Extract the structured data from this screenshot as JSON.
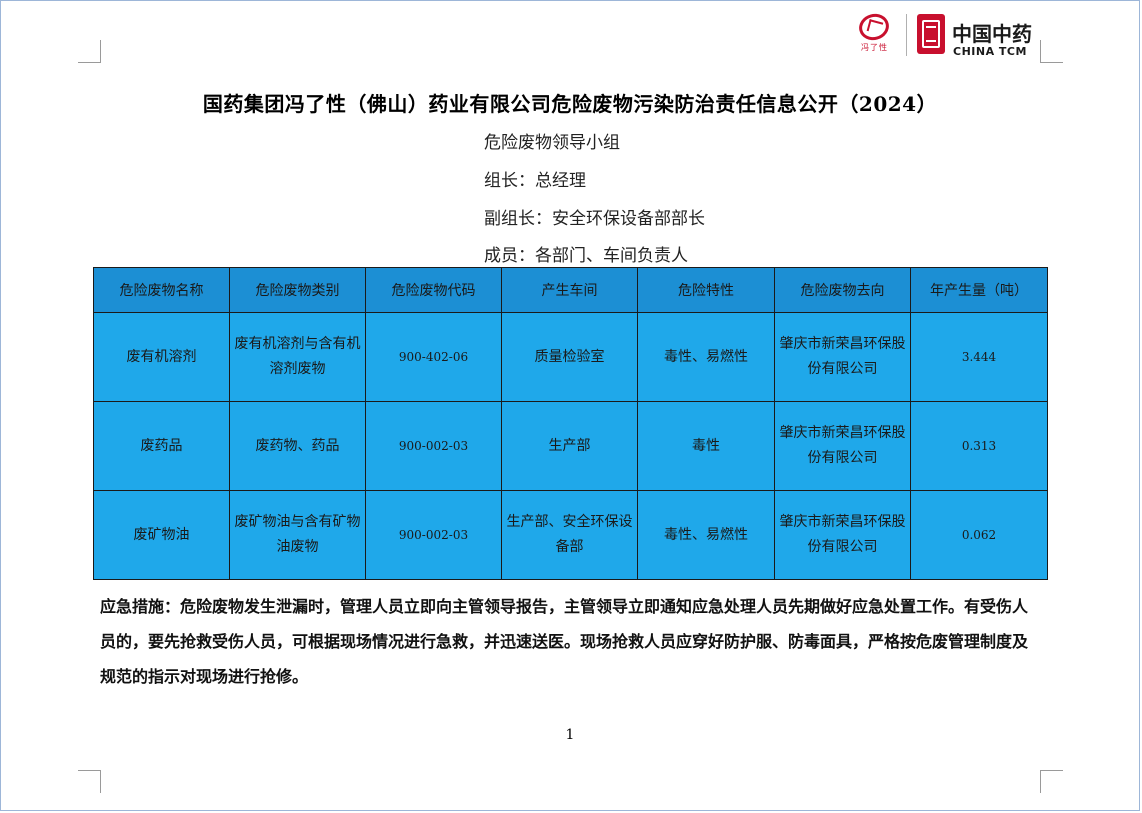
{
  "logos": {
    "company_seal_text": "冯了性",
    "tcm_cn": "中国中药",
    "tcm_en": "CHINA TCM"
  },
  "title": "国药集团冯了性（佛山）药业有限公司危险废物污染防治责任信息公开（2024）",
  "group": {
    "heading": "危险废物领导小组",
    "leader": "组长：总经理",
    "deputy": "副组长：安全环保设备部部长",
    "members": "成员：各部门、车间负责人"
  },
  "table": {
    "headers": [
      "危险废物名称",
      "危险废物类别",
      "危险废物代码",
      "产生车间",
      "危险特性",
      "危险废物去向",
      "年产生量（吨）"
    ],
    "rows": [
      [
        "废有机溶剂",
        "废有机溶剂与含有机溶剂废物",
        "900-402-06",
        "质量检验室",
        "毒性、易燃性",
        "肇庆市新荣昌环保股份有限公司",
        "3.444"
      ],
      [
        "废药品",
        "废药物、药品",
        "900-002-03",
        "生产部",
        "毒性",
        "肇庆市新荣昌环保股份有限公司",
        "0.313"
      ],
      [
        "废矿物油",
        "废矿物油与含有矿物油废物",
        "900-002-03",
        "生产部、安全环保设备部",
        "毒性、易燃性",
        "肇庆市新荣昌环保股份有限公司",
        "0.062"
      ]
    ]
  },
  "emergency": "应急措施：危险废物发生泄漏时，管理人员立即向主管领导报告，主管领导立即通知应急处理人员先期做好应急处置工作。有受伤人员的，要先抢救受伤人员，可根据现场情况进行急救，并迅速送医。现场抢救人员应穿好防护服、防毒面具，严格按危废管理制度及规范的指示对现场进行抢修。",
  "page_number": "1",
  "colors": {
    "table_fill": "#1fa8ea",
    "header_fill": "#1c8fd4",
    "brand_red": "#c8102e"
  }
}
